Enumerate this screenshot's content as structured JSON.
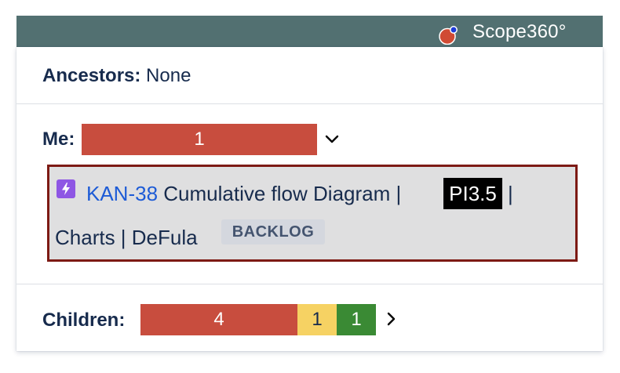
{
  "header": {
    "brand": "Scope360°",
    "logo_icon": "scope360-logo-icon",
    "bar_color": "#527071"
  },
  "ancestors": {
    "label": "Ancestors:",
    "value": "None"
  },
  "me": {
    "label": "Me:",
    "bar": {
      "value": "1",
      "color": "#c84d3e"
    },
    "toggle_icon": "chevron-down-icon",
    "issue": {
      "type_icon": "epic-lightning-icon",
      "key": "KAN-38",
      "title_part1": "Cumulative flow Diagram |",
      "pi_tag": "PI3.5",
      "title_part2": "|",
      "title_line2": "Charts | DeFula",
      "status": "BACKLOG",
      "border_color": "#7d1a14"
    }
  },
  "children": {
    "label": "Children:",
    "segments": [
      {
        "value": "4",
        "color": "#c84d3e"
      },
      {
        "value": "1",
        "color": "#f6d263"
      },
      {
        "value": "1",
        "color": "#3a8a34"
      }
    ],
    "toggle_icon": "chevron-right-icon"
  }
}
